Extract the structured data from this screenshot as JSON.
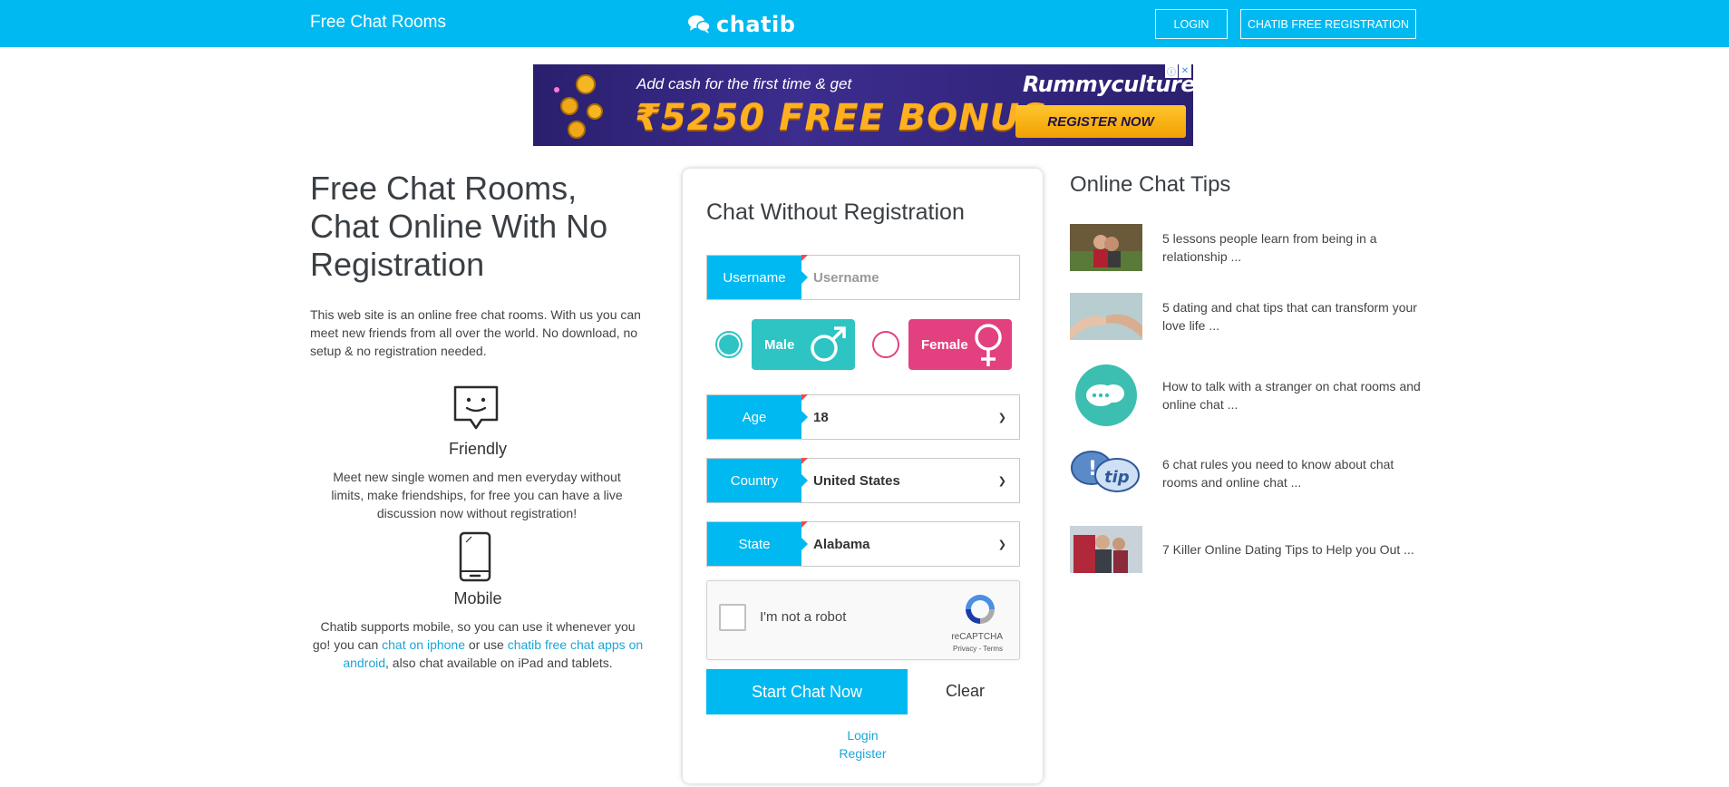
{
  "header": {
    "site_title": "Free Chat Rooms",
    "logo_text": "chatib",
    "login_label": "LOGIN",
    "register_label": "CHATIB FREE REGISTRATION"
  },
  "ad": {
    "line1": "Add cash for the first time & get",
    "line2": "₹5250 FREE BONUS",
    "brand": "Rummyculture",
    "cta": "REGISTER NOW"
  },
  "left": {
    "title": "Free Chat Rooms, Chat Online With No Registration",
    "description": "This web site is an online free chat rooms. With us you can meet new friends from all over the world. No download, no setup & no registration needed.",
    "friendly_title": "Friendly",
    "friendly_text": "Meet new single women and men everyday without limits, make friendships, for free you can have a live discussion now without registration!",
    "mobile_title": "Mobile",
    "mobile_text_1": "Chatib supports mobile, so you can use it whenever you go! you can ",
    "mobile_link_1": "chat on iphone",
    "mobile_text_2": " or use ",
    "mobile_link_2": "chatib free chat apps on android",
    "mobile_text_3": ", also chat available on iPad and tablets."
  },
  "form": {
    "title": "Chat Without Registration",
    "username_label": "Username",
    "username_placeholder": "Username",
    "username_value": "",
    "male_label": "Male",
    "female_label": "Female",
    "selected_gender": "male",
    "age_label": "Age",
    "age_value": "18",
    "country_label": "Country",
    "country_value": "United States",
    "state_label": "State",
    "state_value": "Alabama",
    "recaptcha_label": "I'm not a robot",
    "recaptcha_brand": "reCAPTCHA",
    "recaptcha_links": "Privacy - Terms",
    "start_label": "Start Chat Now",
    "clear_label": "Clear",
    "login_link": "Login",
    "register_link": "Register"
  },
  "tips": {
    "title": "Online Chat Tips",
    "items": [
      {
        "text": "5 lessons people learn from being in a relationship ..."
      },
      {
        "text": "5 dating and chat tips that can transform your love life ..."
      },
      {
        "text": "How to talk with a stranger on chat rooms and online chat ..."
      },
      {
        "text": "6 chat rules you need to know about chat rooms and online chat ..."
      },
      {
        "text": "7 Killer Online Dating Tips to Help you Out ..."
      }
    ]
  },
  "colors": {
    "brand": "#00b9f1",
    "male": "#2ec4c4",
    "female": "#e3407f",
    "link": "#19a6d8"
  }
}
